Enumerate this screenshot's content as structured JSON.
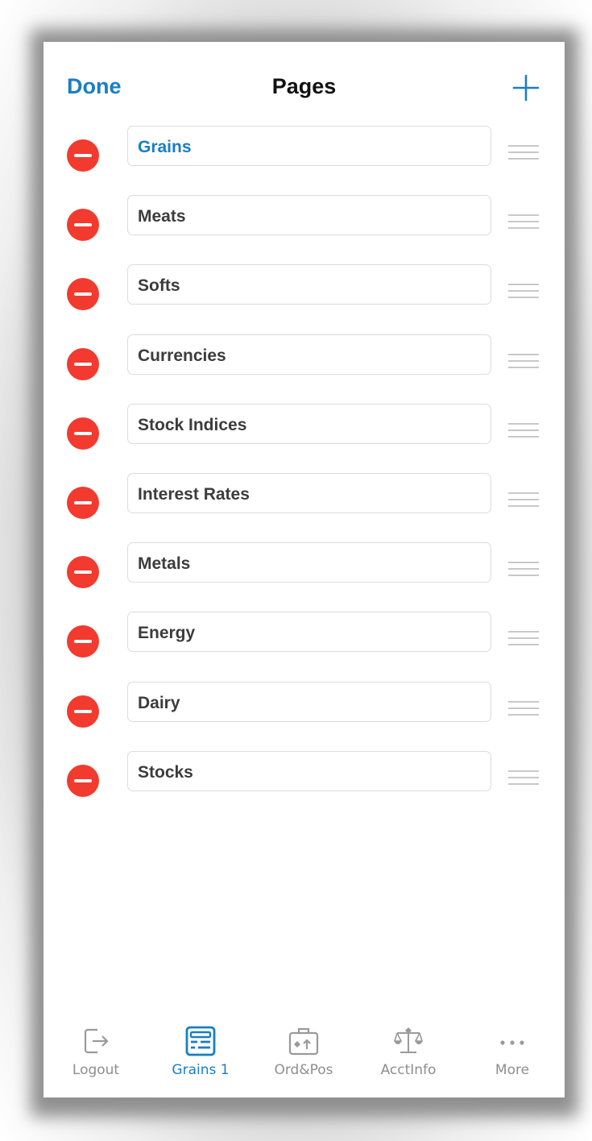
{
  "header": {
    "done_label": "Done",
    "title": "Pages",
    "add_icon": "plus-icon"
  },
  "pages": [
    {
      "label": "Grains",
      "active": true
    },
    {
      "label": "Meats",
      "active": false
    },
    {
      "label": "Softs",
      "active": false
    },
    {
      "label": "Currencies",
      "active": false
    },
    {
      "label": "Stock Indices",
      "active": false
    },
    {
      "label": "Interest Rates",
      "active": false
    },
    {
      "label": "Metals",
      "active": false
    },
    {
      "label": "Energy",
      "active": false
    },
    {
      "label": "Dairy",
      "active": false
    },
    {
      "label": "Stocks",
      "active": false
    }
  ],
  "tabbar": {
    "tabs": [
      {
        "label": "Logout",
        "icon": "logout-icon",
        "active": false
      },
      {
        "label": "Grains 1",
        "icon": "grid-page-icon",
        "active": true
      },
      {
        "label": "Ord&Pos",
        "icon": "briefcase-icon",
        "active": false
      },
      {
        "label": "AcctInfo",
        "icon": "scales-icon",
        "active": false
      },
      {
        "label": "More",
        "icon": "ellipsis-icon",
        "active": false
      }
    ]
  },
  "colors": {
    "accent": "#1a7ec3",
    "delete": "#f23a2f",
    "inactive_tab": "#8e8e8e"
  }
}
